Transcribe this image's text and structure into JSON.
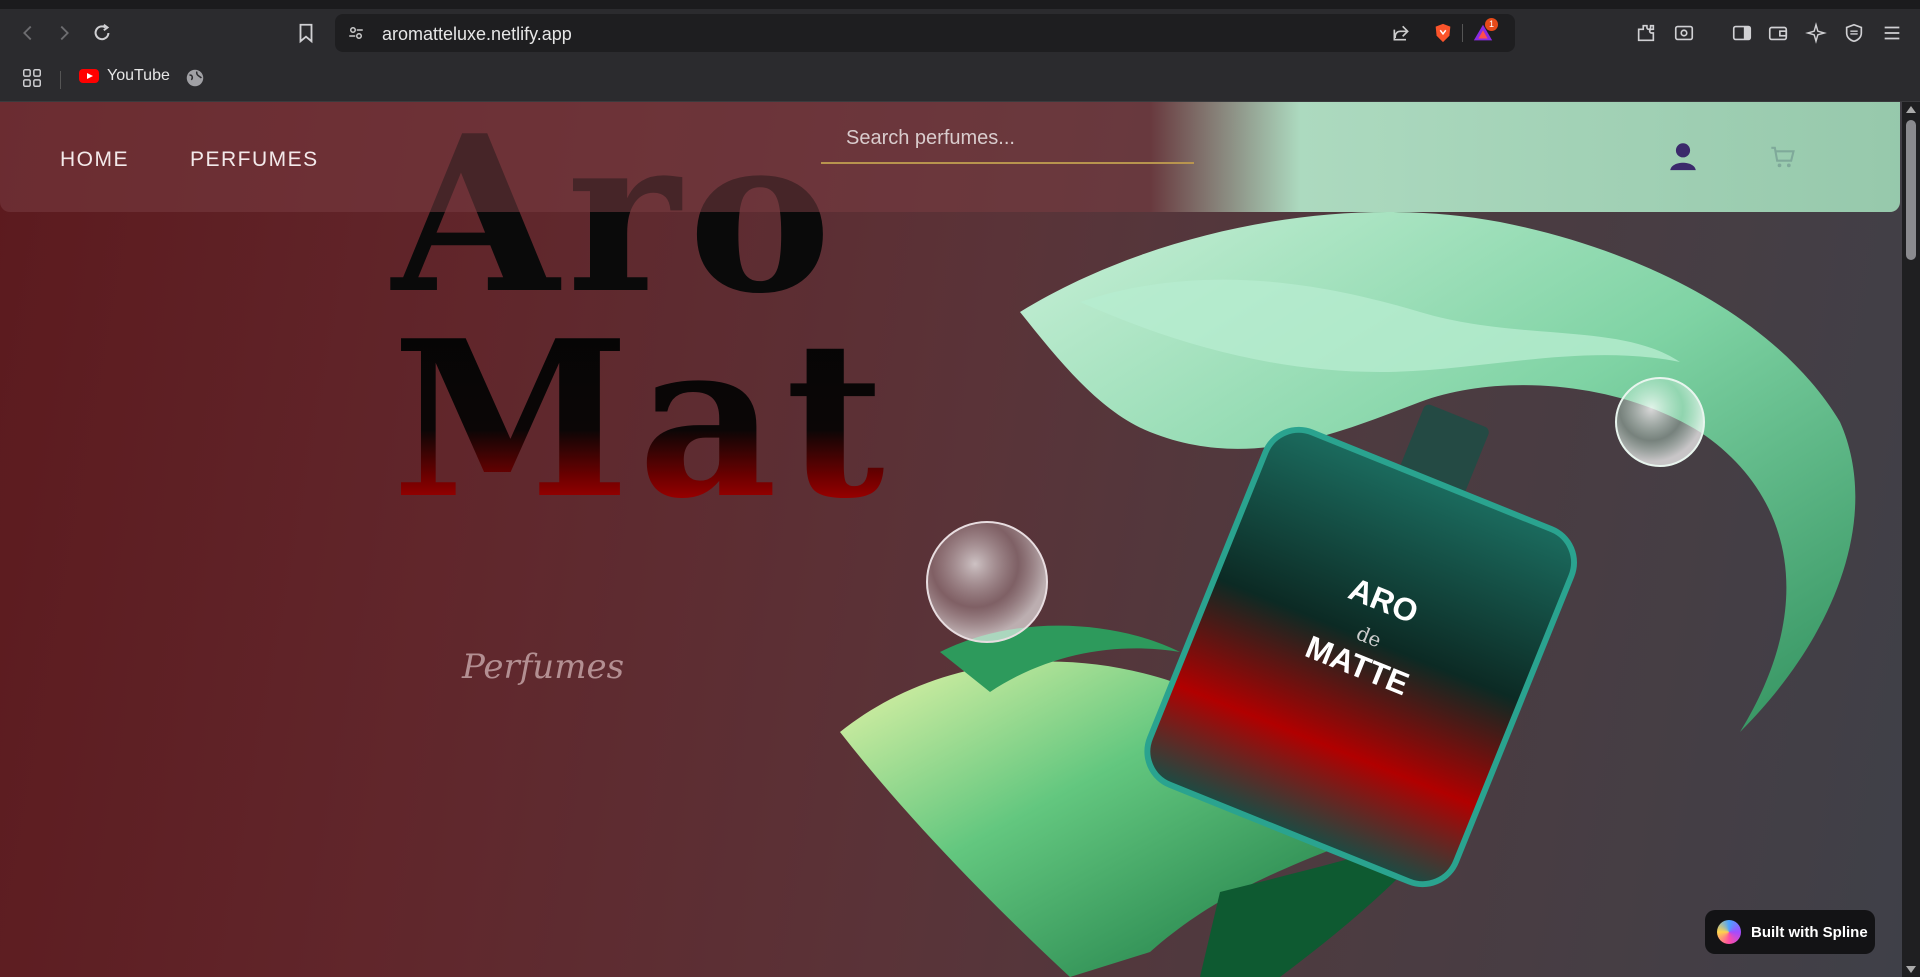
{
  "browser": {
    "url": "aromatteluxe.netlify.app",
    "alert_badge_count": "1",
    "bookmarks": [
      {
        "label": "YouTube"
      }
    ]
  },
  "nav": {
    "links": [
      {
        "label": "HOME"
      },
      {
        "label": "PERFUMES"
      }
    ],
    "search_placeholder": "Search perfumes..."
  },
  "hero": {
    "title_line1": "Aro",
    "title_line2": "Mat",
    "subtitle": "Perfumes",
    "bottle_label": [
      "ARO",
      "de",
      "MATTE"
    ]
  },
  "badge": {
    "label": "Built with Spline"
  },
  "colors": {
    "accent_underline": "#b8944e",
    "title_red": "#c40000",
    "brand_green": "#2a8a5a"
  }
}
